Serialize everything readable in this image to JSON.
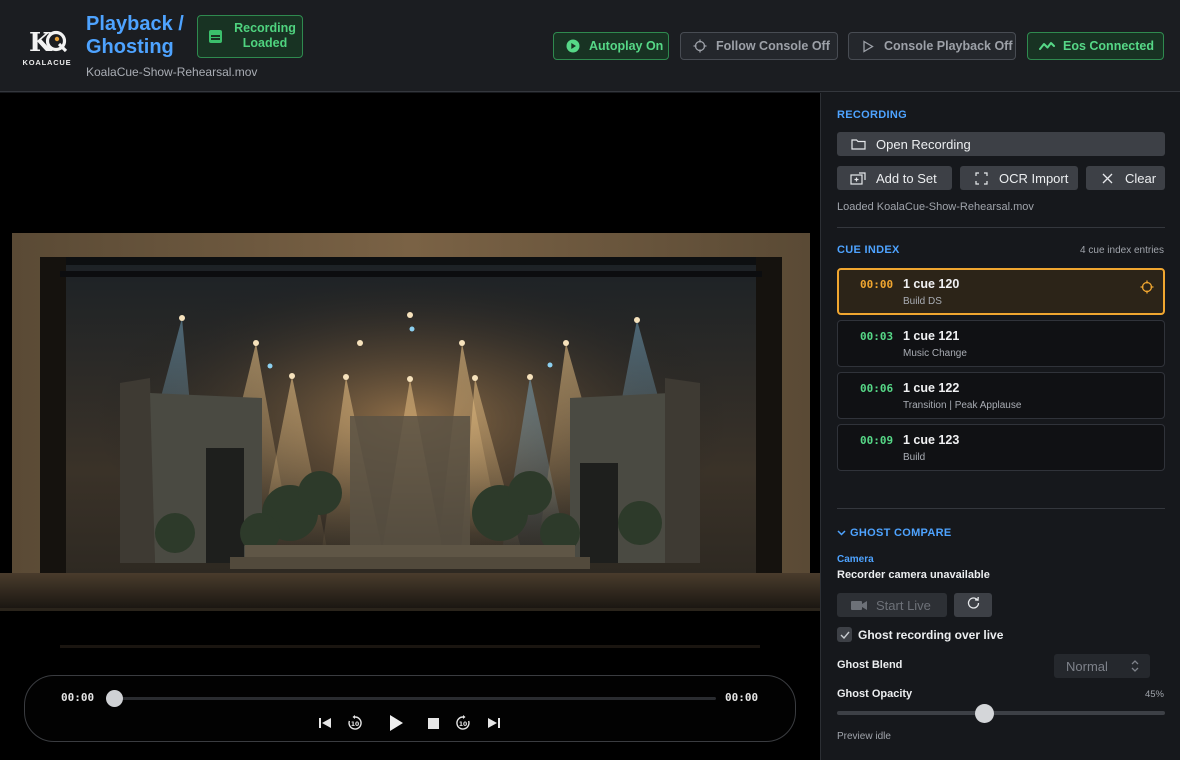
{
  "app": {
    "brand": "KOALACUE",
    "title": "Playback / Ghosting",
    "file": "KoalaCue-Show-Rehearsal.mov",
    "status_badge": "Recording Loaded"
  },
  "header_pills": [
    {
      "label": "Autoplay On",
      "icon": "play-circle-icon",
      "state": "active",
      "color": "#56d887"
    },
    {
      "label": "Follow Console Off",
      "icon": "crosshair-icon",
      "state": "inactive",
      "color": "#9da1a8"
    },
    {
      "label": "Console Playback Off",
      "icon": "play-outline-icon",
      "state": "inactive",
      "color": "#9da1a8"
    },
    {
      "label": "Eos Connected",
      "icon": "signal-wave-icon",
      "state": "active",
      "color": "#56d887"
    }
  ],
  "player": {
    "current_time": "00:00",
    "duration": "00:00",
    "progress": 0,
    "controls": [
      "skip-back-icon",
      "rewind-10-icon",
      "play-icon",
      "stop-icon",
      "forward-10-icon",
      "skip-forward-icon"
    ]
  },
  "recording": {
    "section_title": "RECORDING",
    "open_label": "Open Recording",
    "add_to_set_label": "Add to Set",
    "ocr_label": "OCR Import",
    "clear_label": "Clear",
    "loaded_text": "Loaded KoalaCue-Show-Rehearsal.mov"
  },
  "cue_index": {
    "section_title": "CUE INDEX",
    "count_text": "4 cue index entries",
    "entries": [
      {
        "time": "00:00",
        "name": "1 cue 120",
        "label": "Build DS",
        "active": true
      },
      {
        "time": "00:03",
        "name": "1 cue 121",
        "label": "Music Change",
        "active": false
      },
      {
        "time": "00:06",
        "name": "1 cue 122",
        "label": "Transition | Peak Applause",
        "active": false
      },
      {
        "time": "00:09",
        "name": "1 cue 123",
        "label": "Build",
        "active": false
      }
    ]
  },
  "ghost_compare": {
    "section_title": "GHOST COMPARE",
    "camera_label": "Camera",
    "camera_status": "Recorder camera unavailable",
    "start_live_label": "Start Live",
    "ghost_over_live_label": "Ghost recording over live",
    "ghost_over_live_checked": true,
    "blend_label": "Ghost Blend",
    "blend_value": "Normal",
    "opacity_label": "Ghost Opacity",
    "opacity_value": "45%",
    "opacity_fraction": 0.45,
    "preview_status": "Preview idle"
  },
  "colors": {
    "accent_blue": "#4ea3ff",
    "status_green": "#56d887",
    "active_cue_orange": "#f0a630"
  }
}
